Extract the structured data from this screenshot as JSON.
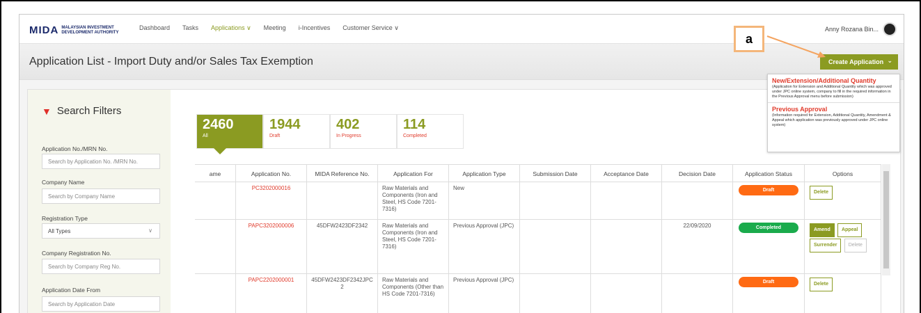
{
  "nav": {
    "logo_mark": "MIDA",
    "logo_text": "MALAYSIAN INVESTMENT DEVELOPMENT AUTHORITY",
    "links": [
      "Dashboard",
      "Tasks",
      "Applications ∨",
      "Meeting",
      "i-Incentives",
      "Customer Service ∨"
    ],
    "user_name": "Anny Rozana Bin..."
  },
  "header": {
    "title": "Application List - Import Duty and/or Sales Tax Exemption",
    "create_button": "Create Application"
  },
  "annotation": {
    "label": "a"
  },
  "dropdown": [
    {
      "title": "New/Extension/Additional Quantity",
      "desc": "(Application for Extension and Additional Quantity which was approved under JPC online system, company to fill in the required information in the Previous Approval menu before submission)"
    },
    {
      "title": "Previous Approval",
      "desc": "(Information required for Extension, Additional Quantity, Amendment & Appeal which application was previously approved under JPC online system)"
    }
  ],
  "filters": {
    "title": "Search Filters",
    "fields": [
      {
        "label": "Application No./MRN No.",
        "placeholder": "Search by Application No. /MRN No."
      },
      {
        "label": "Company Name",
        "placeholder": "Search by Company Name"
      },
      {
        "label": "Registration Type",
        "value": "All Types"
      },
      {
        "label": "Company Registration No.",
        "placeholder": "Search by Company Reg No."
      },
      {
        "label": "Application Date From",
        "placeholder": "Search by Application Date"
      }
    ]
  },
  "stats": [
    {
      "num": "2460",
      "label": "All"
    },
    {
      "num": "1944",
      "label": "Draft"
    },
    {
      "num": "402",
      "label": "In Progress"
    },
    {
      "num": "114",
      "label": "Completed"
    }
  ],
  "table": {
    "columns": [
      "ame",
      "Application No.",
      "MIDA Reference No.",
      "Application For",
      "Application Type",
      "Submission Date",
      "Acceptance Date",
      "Decision Date",
      "Application Status",
      "Options"
    ],
    "rows": [
      {
        "app_no": "PC3202000016",
        "mida_ref": "",
        "app_for": "Raw Materials and Components (Iron and Steel, HS Code 7201-7316)",
        "app_type": "New",
        "submission": "",
        "acceptance": "",
        "decision": "",
        "status": "Draft",
        "options": [
          "Delete"
        ]
      },
      {
        "app_no": "PAPC3202000006",
        "mida_ref": "45DFW2423DF2342",
        "app_for": "Raw Materials and Components (Iron and Steel, HS Code 7201-7316)",
        "app_type": "Previous Approval (JPC)",
        "submission": "",
        "acceptance": "",
        "decision": "22/09/2020",
        "status": "Completed",
        "options": [
          "Amend",
          "Appeal",
          "Surrender",
          "Delete"
        ]
      },
      {
        "app_no": "PAPC2202000001",
        "mida_ref": "45DFW2423DF2342JPC2",
        "app_for": "Raw Materials and Components (Other than HS Code 7201-7316)",
        "app_type": "Previous Approval (JPC)",
        "submission": "",
        "acceptance": "",
        "decision": "",
        "status": "Draft",
        "options": [
          "Delete"
        ]
      }
    ]
  },
  "colors": {
    "accent": "#8b9b22",
    "red": "#e03b2c",
    "draft": "#ff6a13",
    "completed": "#1aab4c"
  }
}
